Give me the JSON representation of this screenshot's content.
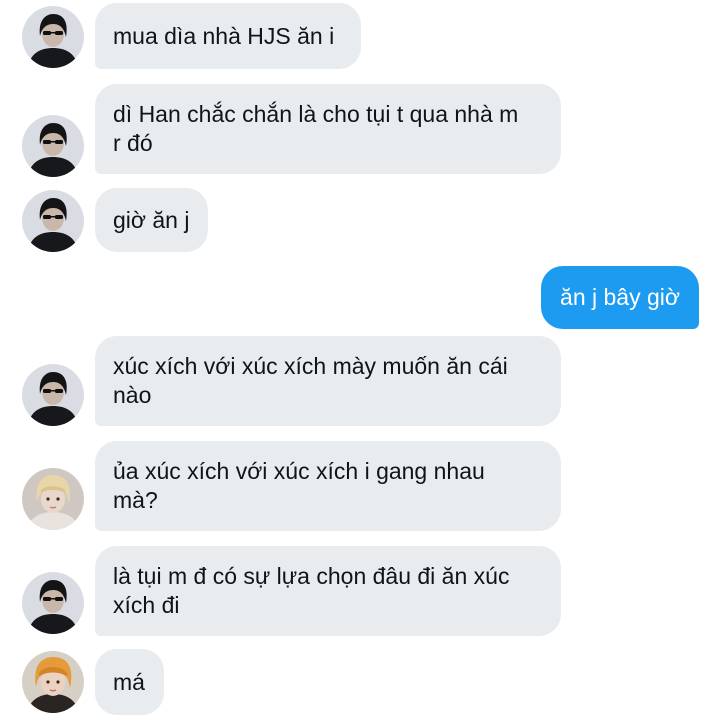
{
  "conversation": {
    "messages": [
      {
        "sender": "friend-a",
        "avatar_icon": "avatar-dark-hair-icon",
        "text": "mua dìa nhà HJS ăn i"
      },
      {
        "sender": "friend-a",
        "avatar_icon": "avatar-dark-hair-icon",
        "text": "dì Han chắc chắn là cho tụi t qua nhà m\nr đó"
      },
      {
        "sender": "friend-a",
        "avatar_icon": "avatar-dark-hair-icon",
        "text": "giờ ăn j"
      },
      {
        "sender": "me",
        "text": "ăn j bây giờ"
      },
      {
        "sender": "friend-a",
        "avatar_icon": "avatar-dark-hair-icon",
        "text": "xúc xích với xúc xích mày muốn ăn cái\nnào"
      },
      {
        "sender": "friend-b",
        "avatar_icon": "avatar-blonde-hair-icon",
        "text": "ủa xúc xích với xúc xích i gang nhau\nmà?"
      },
      {
        "sender": "friend-a",
        "avatar_icon": "avatar-dark-hair-icon",
        "text": "là tụi m đ có sự lựa chọn đâu đi ăn xúc\nxích đi"
      },
      {
        "sender": "friend-c",
        "avatar_icon": "avatar-orange-hair-icon",
        "text": "má"
      }
    ]
  },
  "colors": {
    "incoming_bubble": "#e8ecef",
    "outgoing_bubble": "#1d9bf0",
    "incoming_text": "#0f1419",
    "outgoing_text": "#ffffff"
  }
}
